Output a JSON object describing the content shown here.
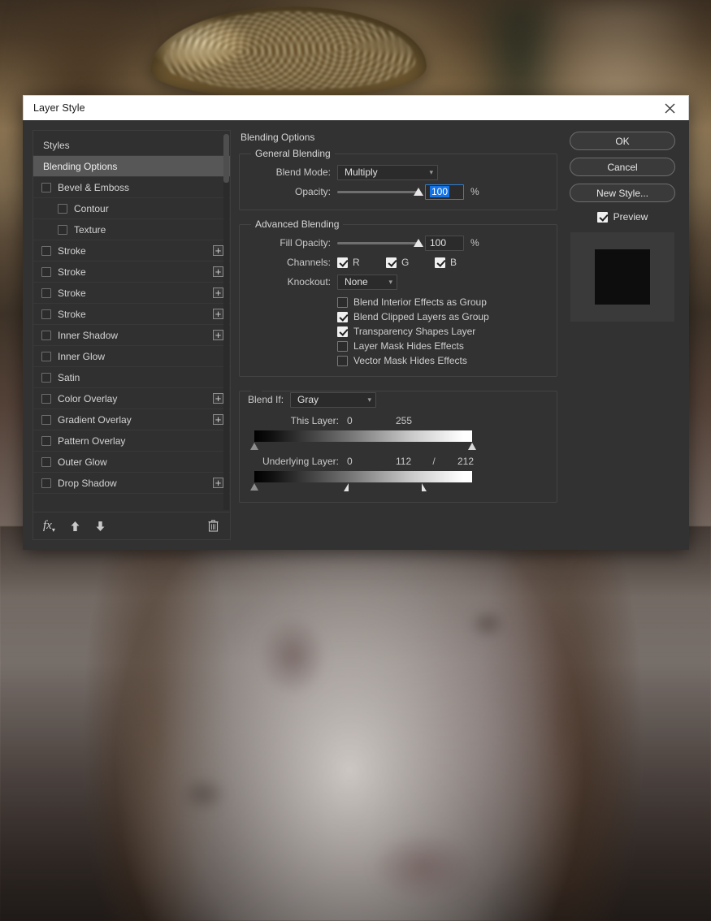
{
  "window": {
    "title": "Layer Style",
    "close_icon": "close-icon"
  },
  "styles_pane": {
    "items": [
      {
        "label": "Styles",
        "checkbox": null,
        "indent": 0,
        "selected": false,
        "plus": false
      },
      {
        "label": "Blending Options",
        "checkbox": null,
        "indent": 0,
        "selected": true,
        "plus": false
      },
      {
        "label": "Bevel & Emboss",
        "checkbox": false,
        "indent": 0,
        "selected": false,
        "plus": false
      },
      {
        "label": "Contour",
        "checkbox": false,
        "indent": 1,
        "selected": false,
        "plus": false
      },
      {
        "label": "Texture",
        "checkbox": false,
        "indent": 1,
        "selected": false,
        "plus": false
      },
      {
        "label": "Stroke",
        "checkbox": false,
        "indent": 0,
        "selected": false,
        "plus": true
      },
      {
        "label": "Stroke",
        "checkbox": false,
        "indent": 0,
        "selected": false,
        "plus": true
      },
      {
        "label": "Stroke",
        "checkbox": false,
        "indent": 0,
        "selected": false,
        "plus": true
      },
      {
        "label": "Stroke",
        "checkbox": false,
        "indent": 0,
        "selected": false,
        "plus": true
      },
      {
        "label": "Inner Shadow",
        "checkbox": false,
        "indent": 0,
        "selected": false,
        "plus": true
      },
      {
        "label": "Inner Glow",
        "checkbox": false,
        "indent": 0,
        "selected": false,
        "plus": false
      },
      {
        "label": "Satin",
        "checkbox": false,
        "indent": 0,
        "selected": false,
        "plus": false
      },
      {
        "label": "Color Overlay",
        "checkbox": false,
        "indent": 0,
        "selected": false,
        "plus": true
      },
      {
        "label": "Gradient Overlay",
        "checkbox": false,
        "indent": 0,
        "selected": false,
        "plus": true
      },
      {
        "label": "Pattern Overlay",
        "checkbox": false,
        "indent": 0,
        "selected": false,
        "plus": false
      },
      {
        "label": "Outer Glow",
        "checkbox": false,
        "indent": 0,
        "selected": false,
        "plus": false
      },
      {
        "label": "Drop Shadow",
        "checkbox": false,
        "indent": 0,
        "selected": false,
        "plus": true
      }
    ],
    "footer": {
      "fx_icon": "fx-icon",
      "move_up_icon": "arrow-up-icon",
      "move_down_icon": "arrow-down-icon",
      "delete_icon": "trash-icon"
    }
  },
  "options": {
    "heading": "Blending Options",
    "general_blending": {
      "legend": "General Blending",
      "blend_mode_label": "Blend Mode:",
      "blend_mode_value": "Multiply",
      "opacity_label": "Opacity:",
      "opacity_value": "100",
      "opacity_unit": "%",
      "opacity_percent": 100
    },
    "advanced_blending": {
      "legend": "Advanced Blending",
      "fill_opacity_label": "Fill Opacity:",
      "fill_opacity_value": "100",
      "fill_opacity_unit": "%",
      "fill_opacity_percent": 100,
      "channels_label": "Channels:",
      "channels": [
        {
          "label": "R",
          "checked": true
        },
        {
          "label": "G",
          "checked": true
        },
        {
          "label": "B",
          "checked": true
        }
      ],
      "knockout_label": "Knockout:",
      "knockout_value": "None",
      "checkboxes": [
        {
          "label": "Blend Interior Effects as Group",
          "checked": false
        },
        {
          "label": "Blend Clipped Layers as Group",
          "checked": true
        },
        {
          "label": "Transparency Shapes Layer",
          "checked": true
        },
        {
          "label": "Layer Mask Hides Effects",
          "checked": false
        },
        {
          "label": "Vector Mask Hides Effects",
          "checked": false
        }
      ]
    },
    "blend_if": {
      "label": "Blend If:",
      "value": "Gray",
      "this_layer": {
        "label": "This Layer:",
        "low": "0",
        "high": "255",
        "low_pos_pct": 0,
        "high_pos_pct": 100
      },
      "underlying_layer": {
        "label": "Underlying Layer:",
        "low": "0",
        "high_left": "112",
        "separator": "/",
        "high_right": "212",
        "low_pos_pct": 0,
        "mid_pos_pct": 42,
        "high_pos_pct": 78
      }
    }
  },
  "actions": {
    "ok": "OK",
    "cancel": "Cancel",
    "new_style": "New Style...",
    "preview_label": "Preview",
    "preview_checked": true
  },
  "colors": {
    "dialog_bg": "#323232",
    "titlebar_bg": "#ffffff",
    "accent_blue": "#1473e6",
    "selected_row": "#575757",
    "text": "#d4d4d4"
  }
}
